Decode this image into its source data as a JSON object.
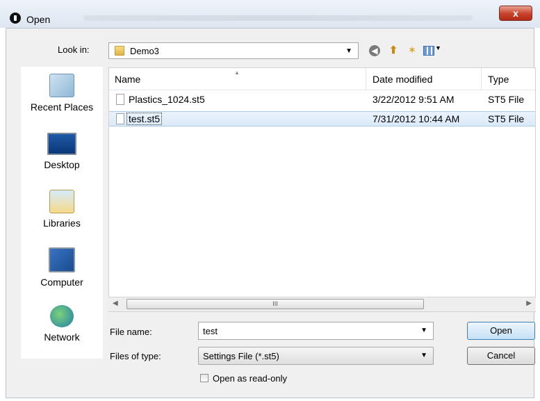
{
  "window": {
    "title": "Open",
    "close_glyph": "x"
  },
  "toolbar": {
    "look_in_label": "Look in:",
    "look_in_value": "Demo3",
    "icons": [
      "back-icon",
      "up-folder-icon",
      "new-folder-icon",
      "view-menu-icon"
    ]
  },
  "places": [
    {
      "label": "Recent Places",
      "icon": "recent-places-icon"
    },
    {
      "label": "Desktop",
      "icon": "desktop-icon"
    },
    {
      "label": "Libraries",
      "icon": "libraries-icon"
    },
    {
      "label": "Computer",
      "icon": "computer-icon"
    },
    {
      "label": "Network",
      "icon": "network-icon"
    }
  ],
  "file_list": {
    "columns": {
      "name": "Name",
      "date": "Date modified",
      "type": "Type"
    },
    "rows": [
      {
        "name": "Plastics_1024.st5",
        "date": "3/22/2012 9:51 AM",
        "type": "ST5 File",
        "selected": false
      },
      {
        "name": "test.st5",
        "date": "7/31/2012 10:44 AM",
        "type": "ST5 File",
        "selected": true
      }
    ],
    "scroll_thumb_glyph": "III"
  },
  "form": {
    "file_name_label": "File name:",
    "file_name_value": "test",
    "file_type_label": "Files of type:",
    "file_type_value": "Settings File (*.st5)",
    "readonly_label": "Open as read-only",
    "readonly_checked": false
  },
  "buttons": {
    "open": "Open",
    "cancel": "Cancel"
  },
  "colors": {
    "close_button": "#c8412a",
    "selection": "#dbeaf9",
    "frame": "#f0f0f0"
  }
}
